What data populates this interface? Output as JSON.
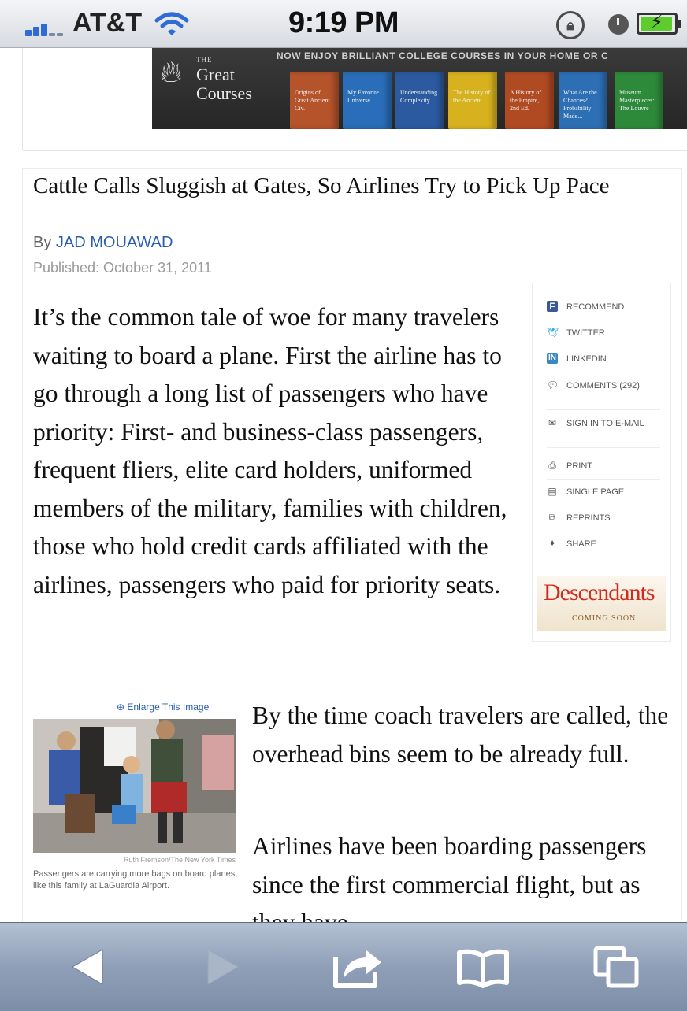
{
  "status_bar": {
    "carrier": "AT&T",
    "time": "9:19 PM",
    "battery_color": "#5ccd2c",
    "icons": [
      "signal-icon",
      "wifi-icon",
      "rotation-lock-icon",
      "alarm-icon",
      "battery-charging-icon"
    ]
  },
  "ad": {
    "brand_small": "THE",
    "brand_name": "Great Courses",
    "tagline": "NOW ENJOY BRILLIANT COLLEGE COURSES IN YOUR HOME OR C",
    "books": [
      {
        "title": "Origins of Great Ancient Civ.",
        "color": "#b5532a"
      },
      {
        "title": "My Favorite Universe",
        "color": "#2a6db8"
      },
      {
        "title": "Understanding Complexity",
        "color": "#2b5aa0"
      },
      {
        "title": "The History of the Ancient...",
        "color": "#d7b21e"
      },
      {
        "title": "A History of the Empire, 2nd Ed.",
        "color": "#b04a23"
      },
      {
        "title": "What Are the Chances? Probability Made...",
        "color": "#2d6fb5"
      },
      {
        "title": "Museum Masterpieces: The Louvre",
        "color": "#2e8a3b"
      }
    ]
  },
  "article": {
    "headline": "Cattle Calls Sluggish at Gates, So Airlines Try to Pick Up Pace",
    "by_prefix": "By",
    "author": "JAD MOUAWAD",
    "published": "Published: October 31, 2011",
    "para1": "It’s the common tale of woe for many travelers waiting to board a plane. First the airline has to go through a long list of passengers who have priority: First- and business-class passengers, frequent fliers, elite card holders, uniformed members of the military, families with children, those who hold credit cards affiliated with the airlines, passengers who paid for priority seats.",
    "para2": "By the time coach travelers are called, the overhead bins seem to be already full.",
    "para3": "Airlines have been boarding passengers since the first commercial flight, but as they have"
  },
  "tools": [
    {
      "label": "RECOMMEND",
      "icon": "facebook-icon"
    },
    {
      "label": "TWITTER",
      "icon": "twitter-icon"
    },
    {
      "label": "LINKEDIN",
      "icon": "linkedin-icon"
    },
    {
      "label": "COMMENTS (292)",
      "icon": "comment-icon"
    },
    {
      "label": "SIGN IN TO E-MAIL",
      "icon": "envelope-icon"
    },
    {
      "label": "PRINT",
      "icon": "printer-icon"
    },
    {
      "label": "SINGLE PAGE",
      "icon": "page-icon"
    },
    {
      "label": "REPRINTS",
      "icon": "reprints-icon"
    },
    {
      "label": "SHARE",
      "icon": "share-icon"
    }
  ],
  "side_ad": {
    "title": "Descendants",
    "subtitle": "COMING SOON"
  },
  "figure": {
    "enlarge": "Enlarge This Image",
    "credit": "Ruth Fremson/The New York Times",
    "caption": "Passengers are carrying more bags on board planes, like this family at LaGuardia Airport."
  },
  "toolbar": {
    "icons": [
      "back-arrow-icon",
      "forward-arrow-icon",
      "share-action-icon",
      "bookmarks-icon",
      "tabs-icon"
    ]
  }
}
